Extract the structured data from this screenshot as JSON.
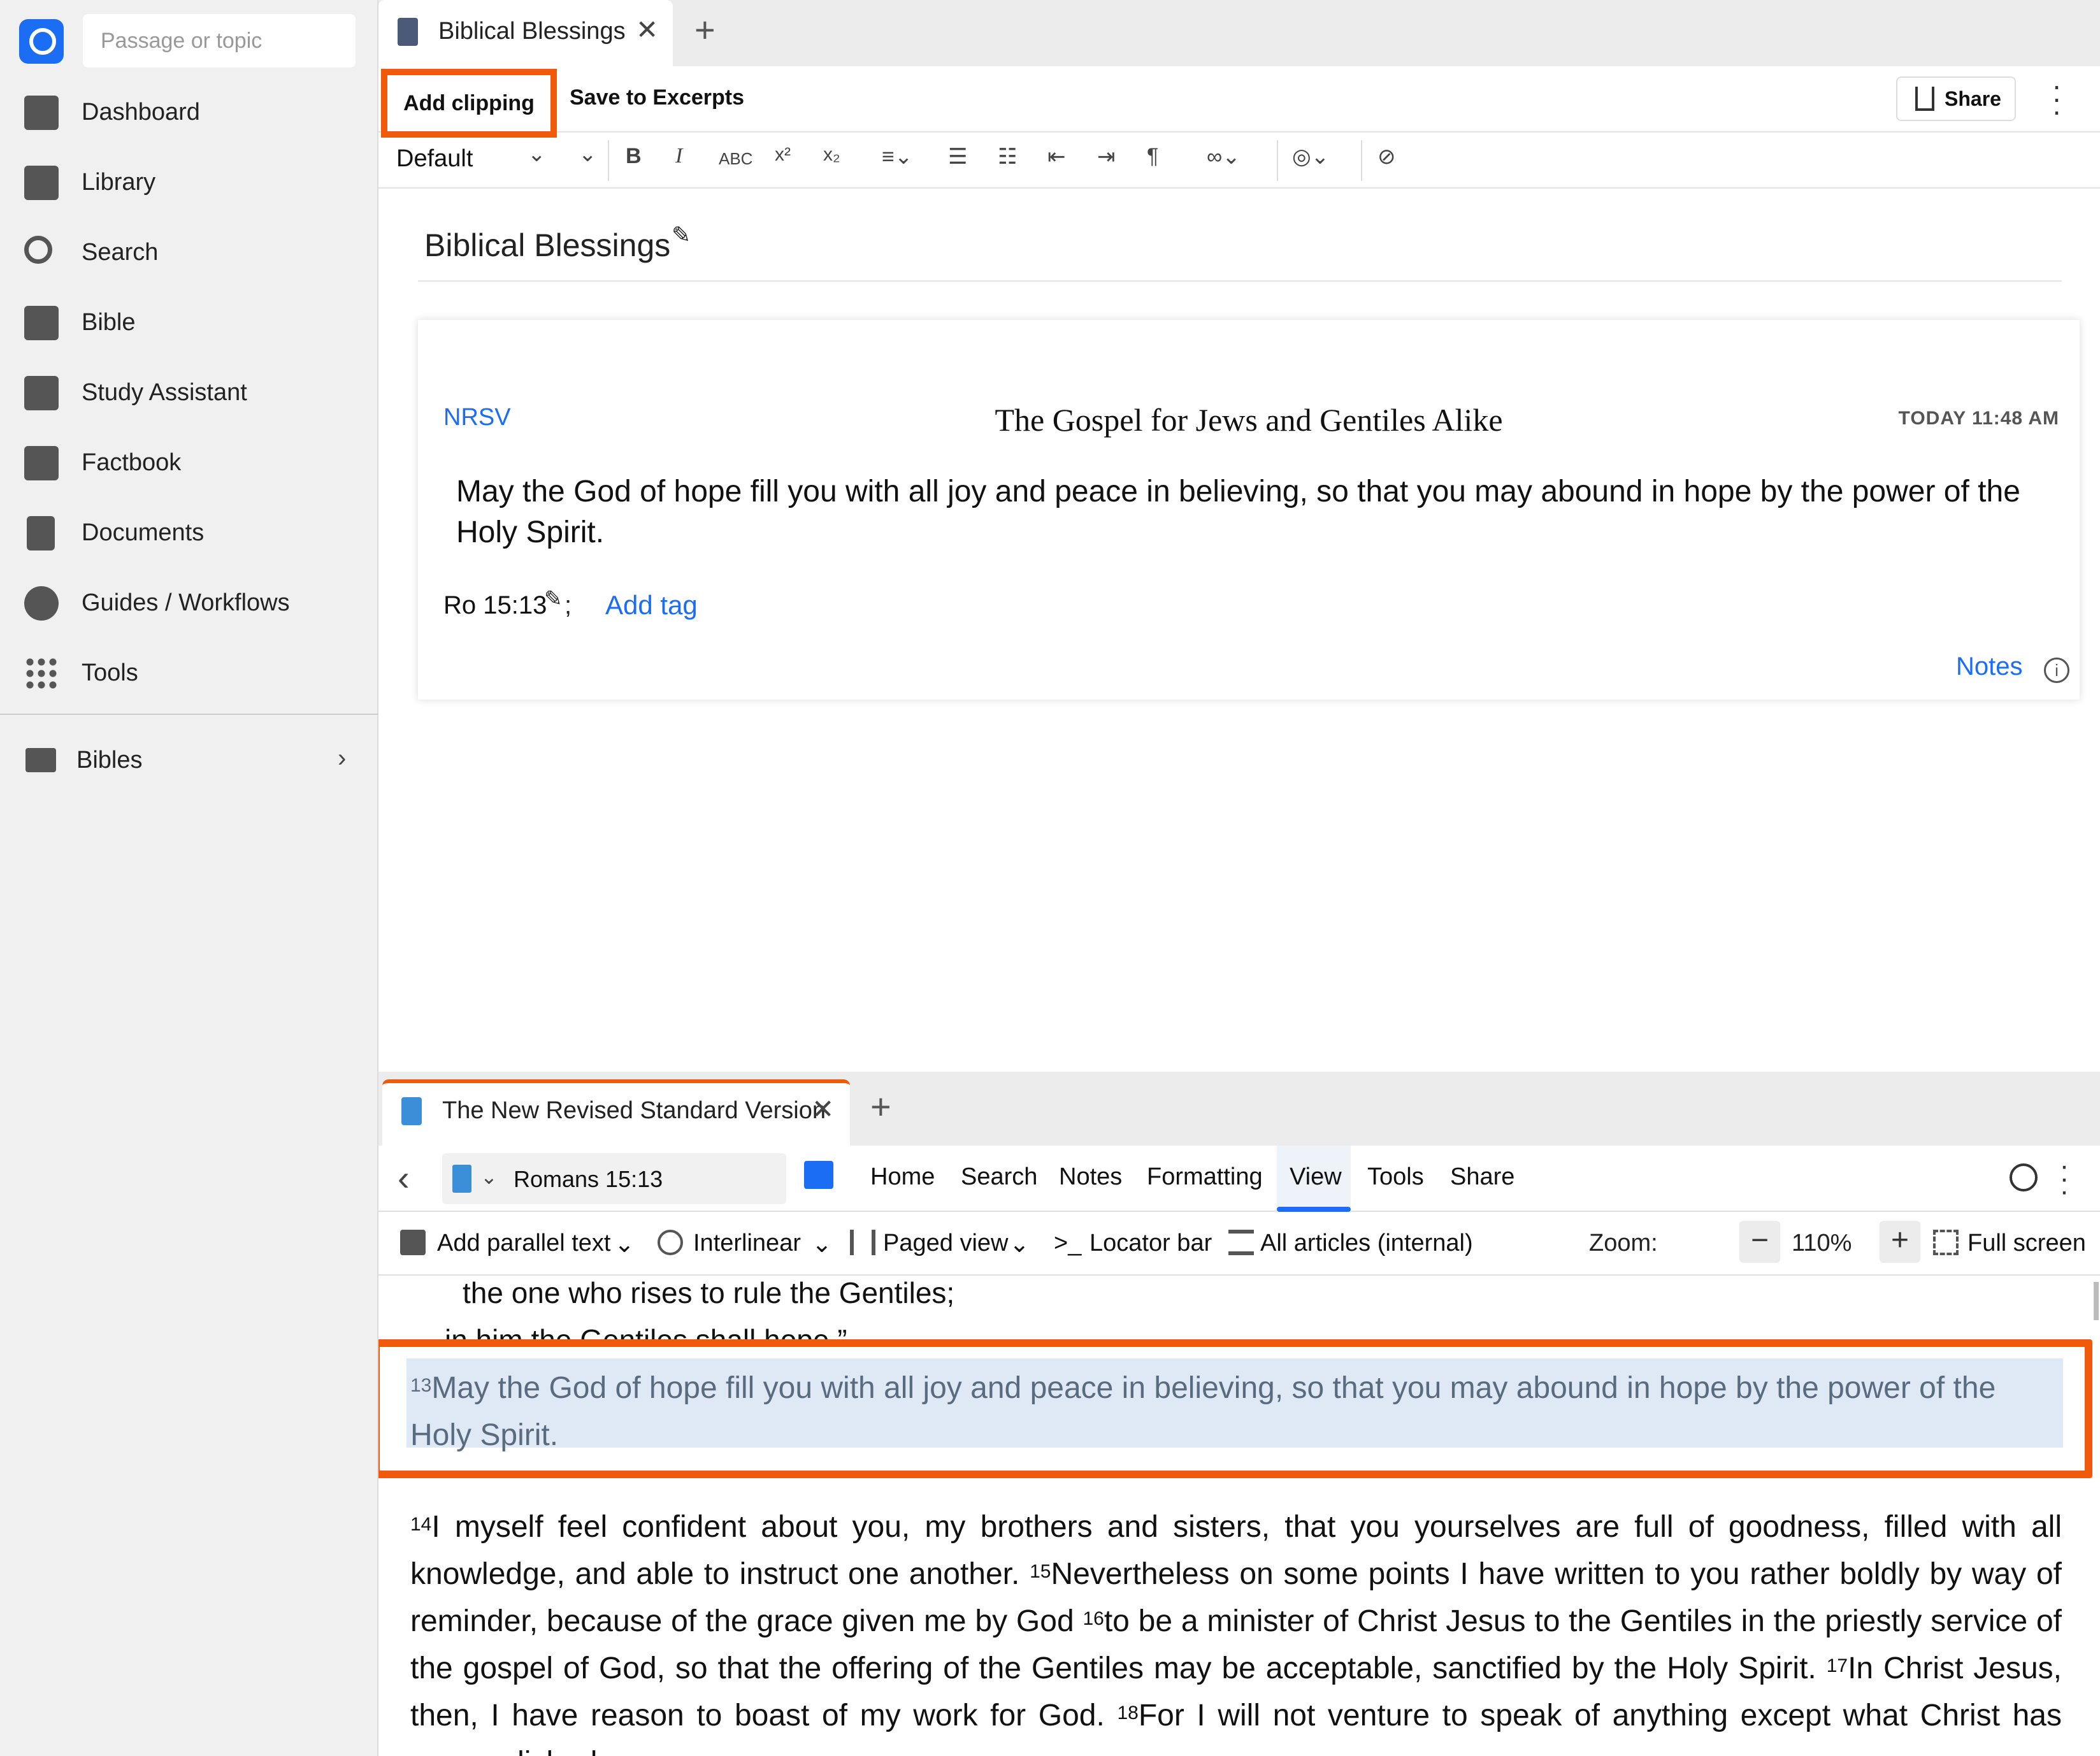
{
  "sidebar": {
    "search_placeholder": "Passage or topic",
    "items": [
      {
        "label": "Dashboard"
      },
      {
        "label": "Library"
      },
      {
        "label": "Search"
      },
      {
        "label": "Bible"
      },
      {
        "label": "Study Assistant"
      },
      {
        "label": "Factbook"
      },
      {
        "label": "Documents"
      },
      {
        "label": "Guides / Workflows"
      },
      {
        "label": "Tools"
      }
    ],
    "folder": {
      "label": "Bibles"
    }
  },
  "top_pane": {
    "tab": {
      "label": "Biblical Blessings"
    },
    "toolbar": {
      "add_clipping": "Add clipping",
      "save_to_excerpts": "Save to Excerpts",
      "share": "Share"
    },
    "format": {
      "style": "Default",
      "bold": "B",
      "italic": "I",
      "smallcaps": "ABC",
      "superscript": "x²",
      "subscript": "x₂"
    },
    "document": {
      "title": "Biblical Blessings",
      "clipping": {
        "version": "NRSV",
        "heading": "The Gospel for Jews and Gentiles Alike",
        "timestamp": "TODAY 11:48 AM",
        "text": "May the God of hope fill you with all joy and peace in believing, so that you may abound in hope by the power of the Holy Spirit.",
        "reference": "Ro 15:13",
        "separator": ";",
        "add_tag": "Add tag",
        "notes": "Notes"
      }
    }
  },
  "bottom_pane": {
    "tab": {
      "label": "The New Revised Standard Version"
    },
    "reference": "Romans 15:13",
    "menu": [
      "Home",
      "Search",
      "Notes",
      "Formatting",
      "View",
      "Tools",
      "Share"
    ],
    "active_menu": "View",
    "viewbar": {
      "parallel": "Add parallel text",
      "interlinear": "Interlinear",
      "paged": "Paged view",
      "locator": "Locator bar",
      "articles": "All articles (internal)",
      "zoom_label": "Zoom:",
      "zoom_value": "110%",
      "fullscreen": "Full screen"
    },
    "text": {
      "poetry_line_1": "the one who rises to rule the Gentiles;",
      "poetry_line_2": "in him the Gentiles shall hope.”",
      "v13_num": "13",
      "v13": "May the God of hope fill you with all joy and peace in believing, so that you may abound in hope by the power of the Holy Spirit.",
      "v14_num": "14",
      "v14": "I myself feel confident about you, my brothers and sisters, that you yourselves are full of goodness, filled with all knowledge, and able to instruct one another.",
      "v15_num": "15",
      "v15": "Nevertheless on some points I have written to you rather boldly by way of reminder, because of the grace given me by God",
      "v16_num": "16",
      "v16": "to be a minister of Christ Jesus to the Gentiles in the priestly service of the gospel of God, so that the offering of the Gentiles may be acceptable, sanctified by the Holy Spirit.",
      "v17_num": "17",
      "v17": "In Christ Jesus, then, I have reason to boast of my work for God.",
      "v18_num": "18",
      "v18": "For I will not venture to speak of anything except what Christ has accomplished"
    }
  },
  "colors": {
    "accent": "#1b6ef3",
    "highlight_border": "#f05a0a",
    "selection": "#dfe9f6"
  }
}
